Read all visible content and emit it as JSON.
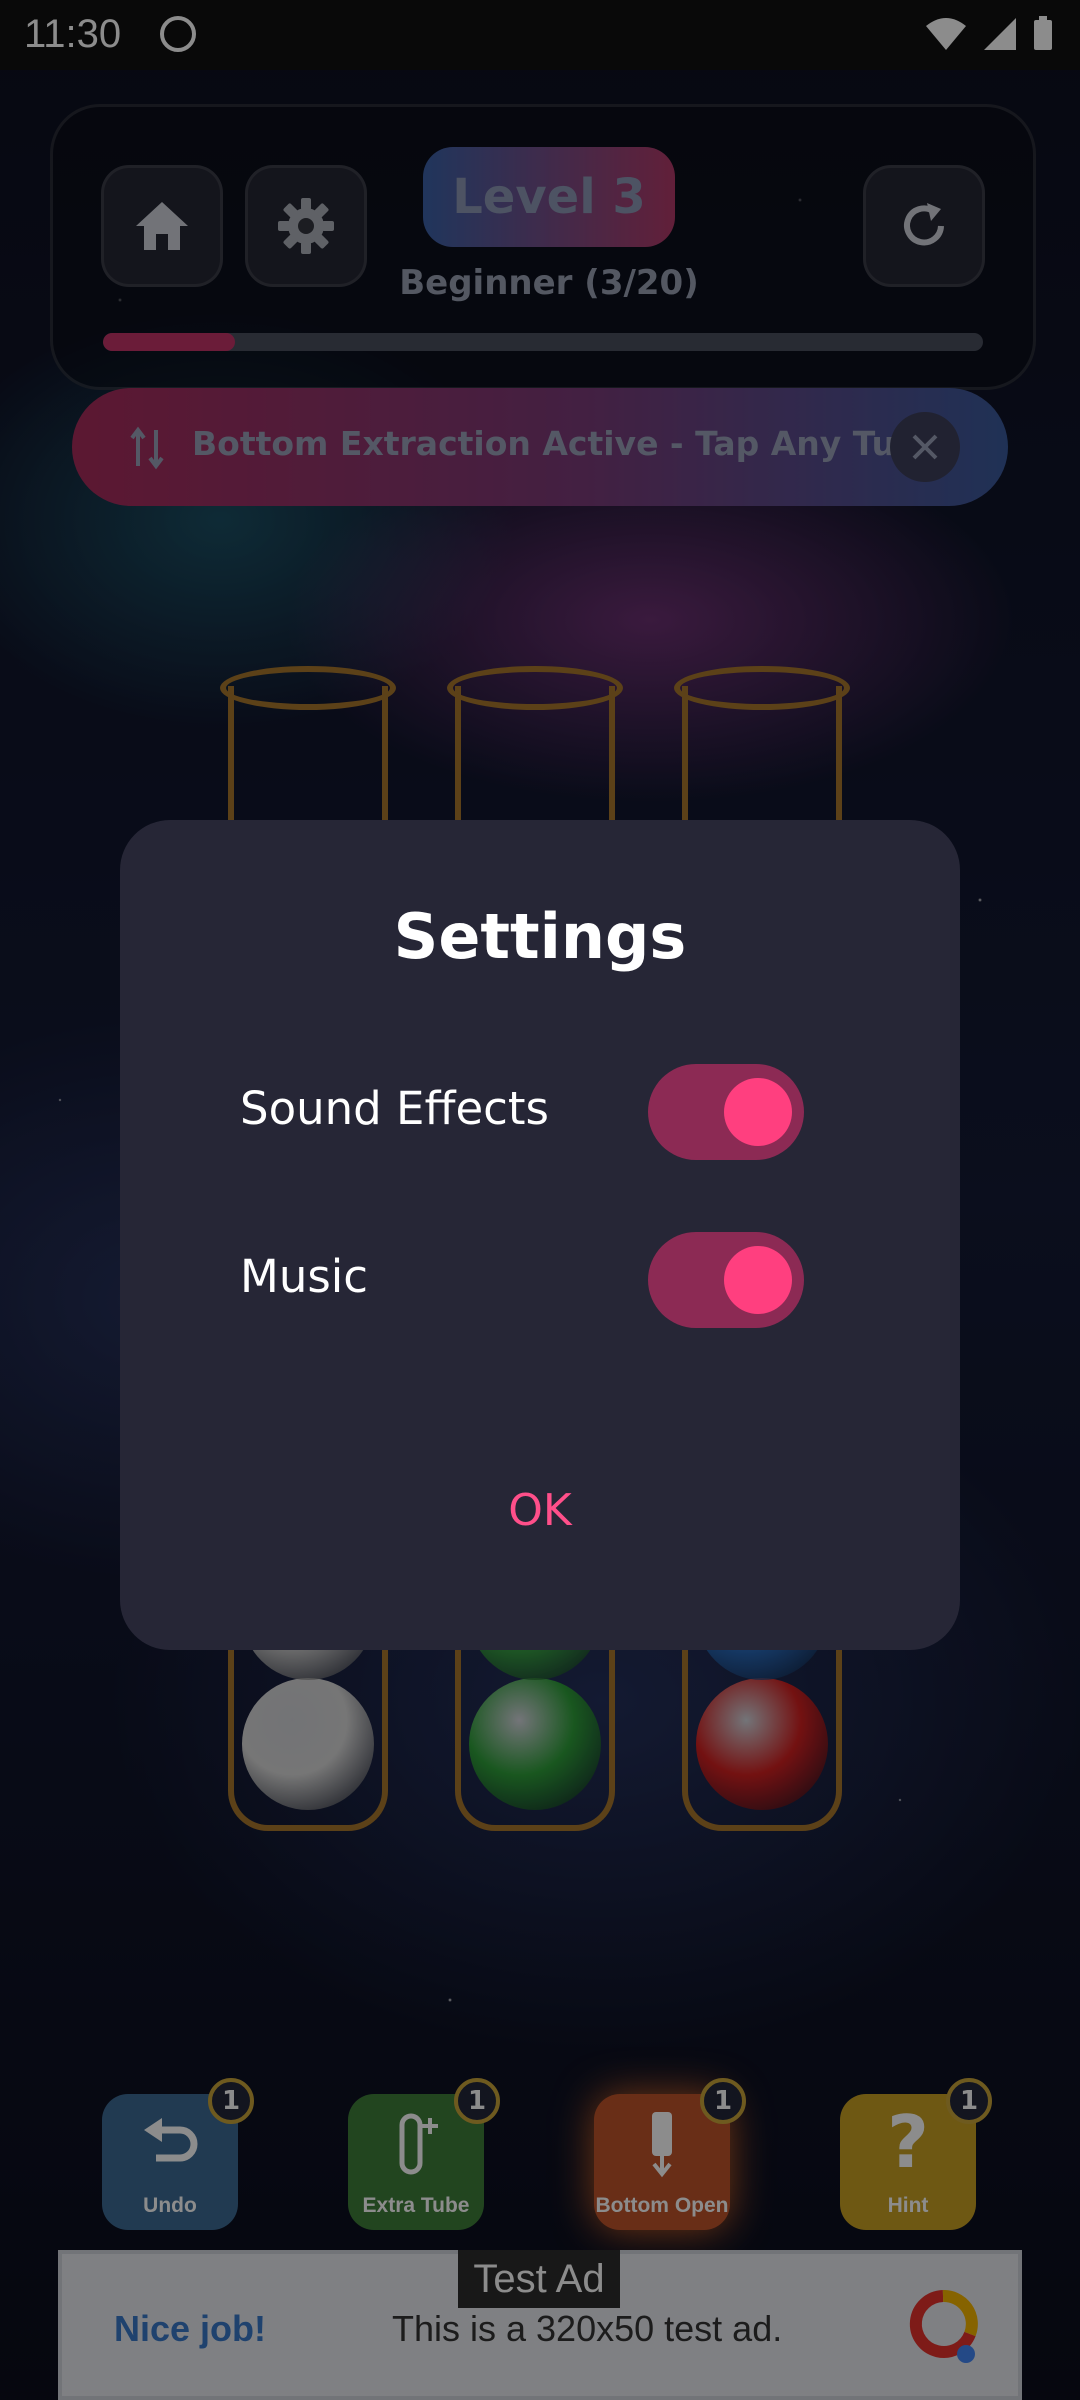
{
  "status_bar": {
    "time": "11:30"
  },
  "header": {
    "level_label": "Level 3",
    "difficulty": "Beginner (3/20)",
    "progress_fraction": 0.15
  },
  "banner": {
    "text": "Bottom Extraction Active - Tap Any Tube"
  },
  "tubes": [
    {
      "balls": [
        "#d7d7d7",
        "#cfcfcf"
      ]
    },
    {
      "balls": [
        "#2f9f3a",
        "#3aa845"
      ]
    },
    {
      "balls": [
        "#d22020",
        "#2a6fc4"
      ]
    }
  ],
  "settings_dialog": {
    "title": "Settings",
    "sound_effects_label": "Sound Effects",
    "sound_effects_on": true,
    "music_label": "Music",
    "music_on": true,
    "ok_label": "OK"
  },
  "powerups": [
    {
      "label": "Undo",
      "count": "1",
      "color": "#3c6b94"
    },
    {
      "label": "Extra Tube",
      "count": "1",
      "color": "#3f7f3a"
    },
    {
      "label": "Bottom Open",
      "count": "1",
      "color": "#c0552a"
    },
    {
      "label": "Hint",
      "count": "1",
      "color": "#c8a024"
    }
  ],
  "ad": {
    "tag": "Test Ad",
    "headline": "Nice job!",
    "body": "This is a 320x50 test ad."
  }
}
